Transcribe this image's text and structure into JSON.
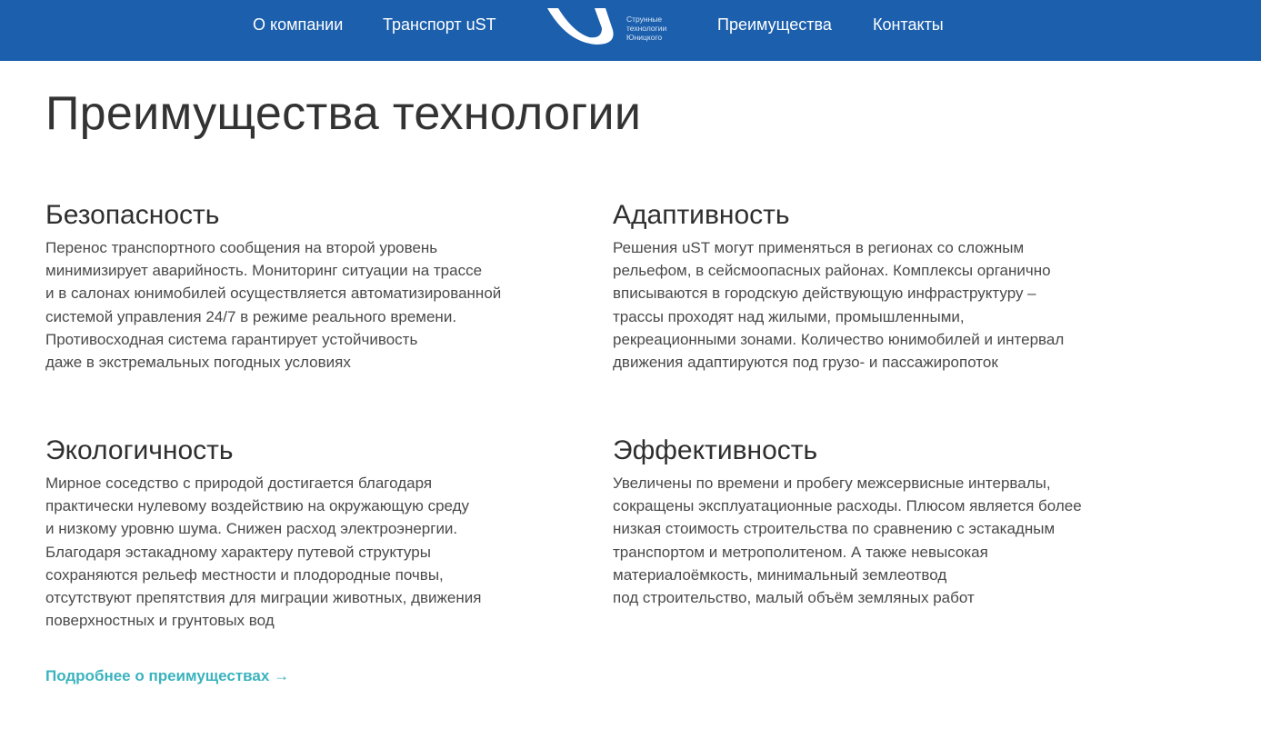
{
  "header": {
    "nav": [
      {
        "label": "О компании"
      },
      {
        "label": "Транспорт uST"
      },
      {
        "label": "Преимущества"
      },
      {
        "label": "Контакты"
      }
    ],
    "logo": {
      "lines": [
        "Струнные",
        "технологии",
        "Юницкого"
      ]
    }
  },
  "main": {
    "title": "Преимущества технологии",
    "sections": [
      {
        "title": "Безопасность",
        "lines": [
          "Перенос транспортного сообщения на второй уровень",
          "минимизирует аварийность. Мониторинг ситуации на трассе",
          "и в салонах юнимобилей осуществляется автоматизированной",
          "системой управления 24/7 в режиме реального времени.",
          "Противосходная система гарантирует устойчивость",
          "даже в экстремальных погодных условиях"
        ]
      },
      {
        "title": "Адаптивность",
        "lines": [
          "Решения uST могут применяться в регионах со сложным",
          "рельефом, в сейсмоопасных районах. Комплексы органично",
          "вписываются в городскую действующую инфраструктуру –",
          "трассы проходят над жилыми, промышленными,",
          "рекреационными зонами. Количество юнимобилей и интервал",
          "движения адаптируются под грузо- и пассажиропоток"
        ]
      },
      {
        "title": "Экологичность",
        "lines": [
          "Мирное соседство с природой достигается благодаря",
          "практически нулевому воздействию на окружающую среду",
          "и низкому уровню шума. Снижен расход электроэнергии.",
          "Благодаря эстакадному характеру путевой структуры",
          "сохраняются рельеф местности и плодородные почвы,",
          "отсутствуют препятствия для миграции животных, движения",
          "поверхностных и грунтовых вод"
        ]
      },
      {
        "title": "Эффективность",
        "lines": [
          "Увеличены по времени и пробегу межсервисные интервалы,",
          "сокращены эксплуатационные расходы. Плюсом является более",
          "низкая стоимость строительства по сравнению с эстакадным",
          "транспортом и метрополитеном. А также невысокая",
          "материалоёмкость, минимальный землеотвод",
          "под строительство, малый объём земляных работ"
        ]
      }
    ],
    "more_link": "Подробнее о преимуществах →"
  },
  "colors": {
    "header_bg": "#1b5fad",
    "accent_link": "#3bb3be"
  }
}
